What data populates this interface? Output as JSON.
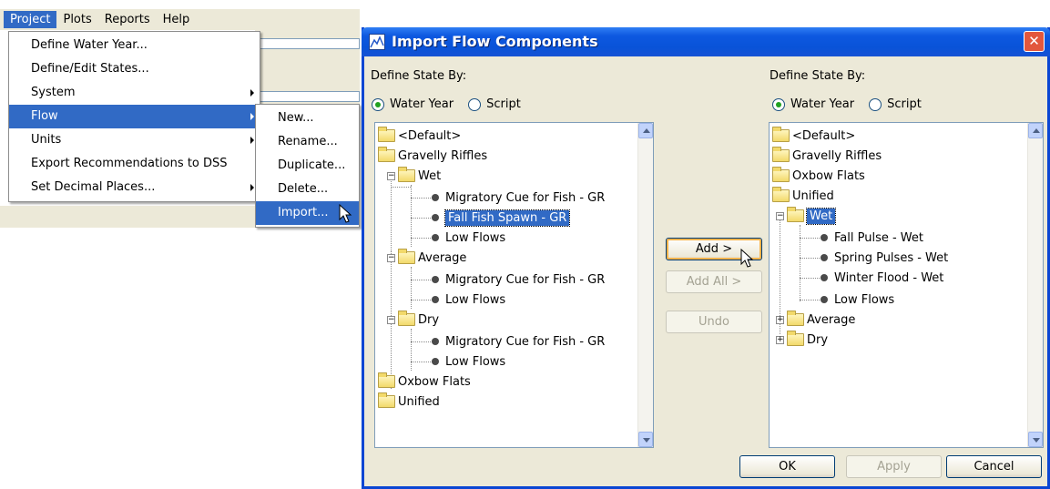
{
  "menubar": {
    "items": [
      "Project",
      "Plots",
      "Reports",
      "Help"
    ]
  },
  "project_menu": {
    "items": [
      {
        "label": "Define Water Year..."
      },
      {
        "label": "Define/Edit States..."
      },
      {
        "label": "System"
      },
      {
        "label": "Flow"
      },
      {
        "label": "Units"
      },
      {
        "label": "Export Recommendations to DSS"
      },
      {
        "label": "Set Decimal Places..."
      }
    ]
  },
  "flow_submenu": {
    "items": [
      {
        "label": "New..."
      },
      {
        "label": "Rename..."
      },
      {
        "label": "Duplicate..."
      },
      {
        "label": "Delete..."
      },
      {
        "label": "Import..."
      }
    ]
  },
  "dialog": {
    "title": "Import Flow Components",
    "close_glyph": "✕",
    "left": {
      "define_label": "Define State By:",
      "radio_water_year": "Water Year",
      "radio_script": "Script",
      "tree": [
        "<Default>",
        "Gravelly Riffles",
        "Wet",
        "Migratory Cue for Fish - GR",
        "Fall Fish Spawn - GR",
        "Low Flows",
        "Average",
        "Migratory Cue for Fish - GR",
        "Low Flows",
        "Dry",
        "Migratory Cue for Fish - GR",
        "Low Flows",
        "Oxbow Flats",
        "Unified"
      ]
    },
    "right": {
      "define_label": "Define State By:",
      "radio_water_year": "Water Year",
      "radio_script": "Script",
      "tree": [
        "<Default>",
        "Gravelly Riffles",
        "Oxbow Flats",
        "Unified",
        "Wet",
        "Fall Pulse - Wet",
        "Spring Pulses - Wet",
        "Winter Flood - Wet",
        "Low Flows",
        "Average",
        "Dry"
      ]
    },
    "buttons": {
      "add": "Add >",
      "add_all": "Add All >",
      "undo": "Undo",
      "ok": "OK",
      "apply": "Apply",
      "cancel": "Cancel"
    }
  },
  "colors": {
    "highlight": "#316ac5",
    "titlebar": "#0953d8",
    "dialog_bg": "#ece9d8"
  }
}
